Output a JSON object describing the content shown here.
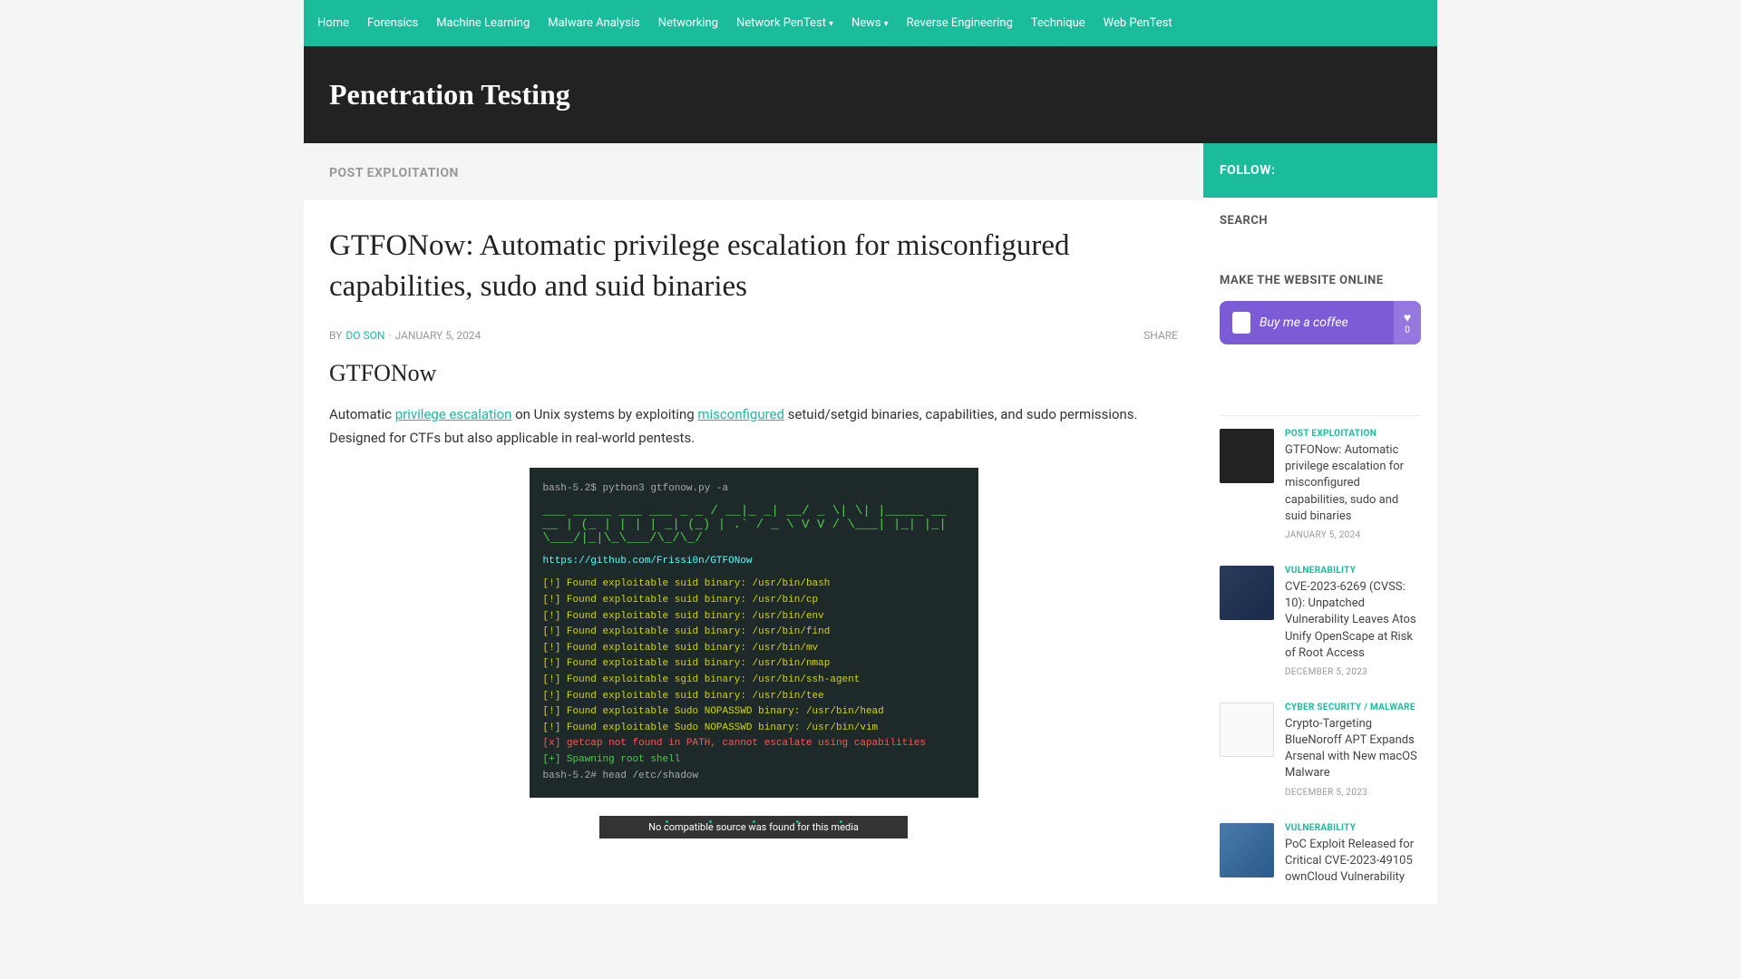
{
  "nav": {
    "items": [
      {
        "label": "Home",
        "dropdown": false
      },
      {
        "label": "Forensics",
        "dropdown": false
      },
      {
        "label": "Machine Learning",
        "dropdown": false
      },
      {
        "label": "Malware Analysis",
        "dropdown": false
      },
      {
        "label": "Networking",
        "dropdown": false
      },
      {
        "label": "Network PenTest",
        "dropdown": true
      },
      {
        "label": "News",
        "dropdown": true
      },
      {
        "label": "Reverse Engineering",
        "dropdown": false
      },
      {
        "label": "Technique",
        "dropdown": false
      },
      {
        "label": "Web PenTest",
        "dropdown": false
      }
    ]
  },
  "site": {
    "title": "Penetration Testing"
  },
  "breadcrumb": {
    "category": "POST EXPLOITATION"
  },
  "article": {
    "title": "GTFONow: Automatic privilege escalation for misconfigured capabilities, sudo and suid binaries",
    "by_label": "BY",
    "author": "DO SON",
    "date_separator": "·",
    "date": "JANUARY 5, 2024",
    "share_label": "SHARE",
    "section_heading": "GTFONow",
    "intro_pre": "Automatic ",
    "intro_link1": "privilege escalation",
    "intro_mid": " on Unix systems by exploiting ",
    "intro_link2": "misconfigured",
    "intro_post": " setuid/setgid binaries, capabilities, and sudo permissions. Designed for CTFs but also applicable in real-world pentests.",
    "terminal": {
      "line1": "bash-5.2$ python3 gtfonow.py -a",
      "url": "https://github.com/Frissi0n/GTFONow",
      "findings": [
        "[!] Found exploitable suid binary: /usr/bin/bash",
        "[!] Found exploitable suid binary: /usr/bin/cp",
        "[!] Found exploitable suid binary: /usr/bin/env",
        "[!] Found exploitable suid binary: /usr/bin/find",
        "[!] Found exploitable suid binary: /usr/bin/mv",
        "[!] Found exploitable suid binary: /usr/bin/nmap",
        "[!] Found exploitable sgid binary: /usr/bin/ssh-agent",
        "[!] Found exploitable suid binary: /usr/bin/tee",
        "[!] Found exploitable Sudo NOPASSWD binary: /usr/bin/head",
        "[!] Found exploitable Sudo NOPASSWD binary: /usr/bin/vim"
      ],
      "error_line": "[x] getcap not found in PATH, cannot escalate using capabilities",
      "spawn_line": "[+] Spawning root shell",
      "final_line": "bash-5.2# head /etc/shadow"
    },
    "video_error": "No compatible source was found for this media"
  },
  "sidebar": {
    "follow_label": "FOLLOW:",
    "search_heading": "SEARCH",
    "online_heading": "MAKE THE WEBSITE ONLINE",
    "coffee_text": "Buy me a coffee",
    "coffee_count": "0",
    "posts": [
      {
        "category": "POST EXPLOITATION",
        "title": "GTFONow: Automatic privilege escalation for misconfigured capabilities, sudo and suid binaries",
        "date": "JANUARY 5, 2024",
        "thumb": "terminal"
      },
      {
        "category": "VULNERABILITY",
        "title": "CVE-2023-6269 (CVSS: 10): Unpatched Vulnerability Leaves Atos Unify OpenScape at Risk of Root Access",
        "date": "DECEMBER 5, 2023",
        "thumb": "security"
      },
      {
        "category": "CYBER SECURITY / MALWARE",
        "title": "Crypto-Targeting BlueNoroff APT Expands Arsenal with New macOS Malware",
        "date": "DECEMBER 5, 2023",
        "thumb": "code"
      },
      {
        "category": "VULNERABILITY",
        "title": "PoC Exploit Released for Critical CVE-2023-49105 ownCloud Vulnerability",
        "date": "",
        "thumb": "blue"
      }
    ]
  }
}
